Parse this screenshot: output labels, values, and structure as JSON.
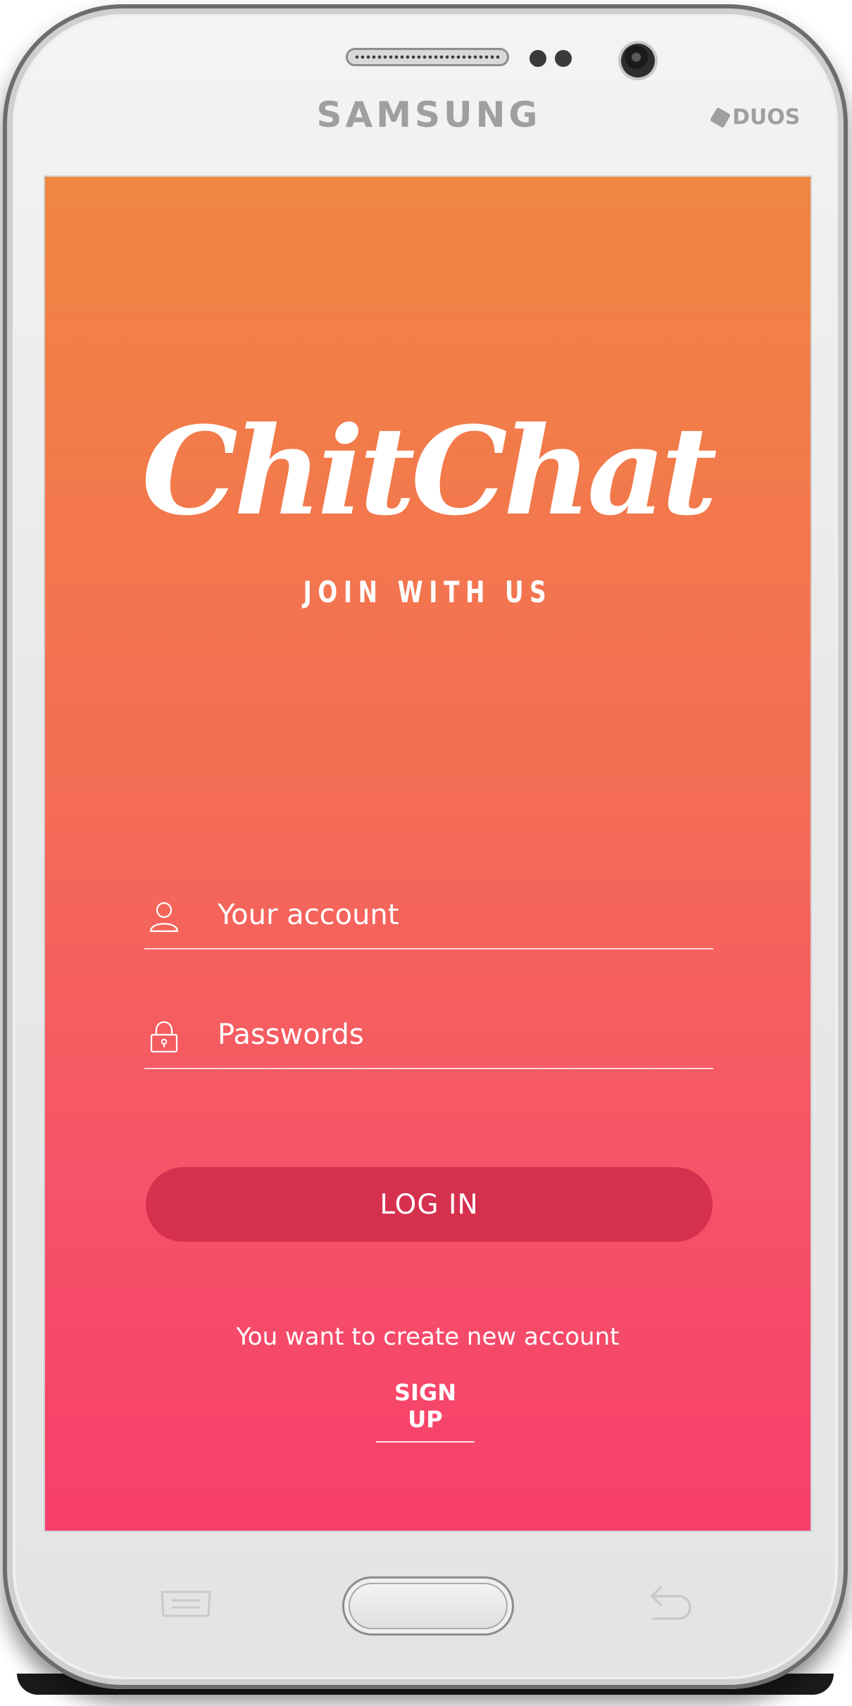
{
  "device": {
    "brand": "SAMSUNG",
    "model_badge": "DUOS"
  },
  "app": {
    "logo_text": "ChitChat",
    "tagline": "JOIN WITH US"
  },
  "login_form": {
    "account_placeholder": "Your account",
    "account_value": "",
    "password_placeholder": "Passwords",
    "password_value": "",
    "login_label": "LOG IN"
  },
  "signup": {
    "prompt": "You want to create new account",
    "link_label": "SIGN UP"
  },
  "icons": {
    "account": "user-icon",
    "password": "lock-icon",
    "menu_key": "menu-icon",
    "back_key": "back-icon"
  },
  "colors": {
    "gradient_top": "#f18642",
    "gradient_bottom": "#f73f6a",
    "login_button": "#d6304f",
    "text": "#ffffff"
  }
}
